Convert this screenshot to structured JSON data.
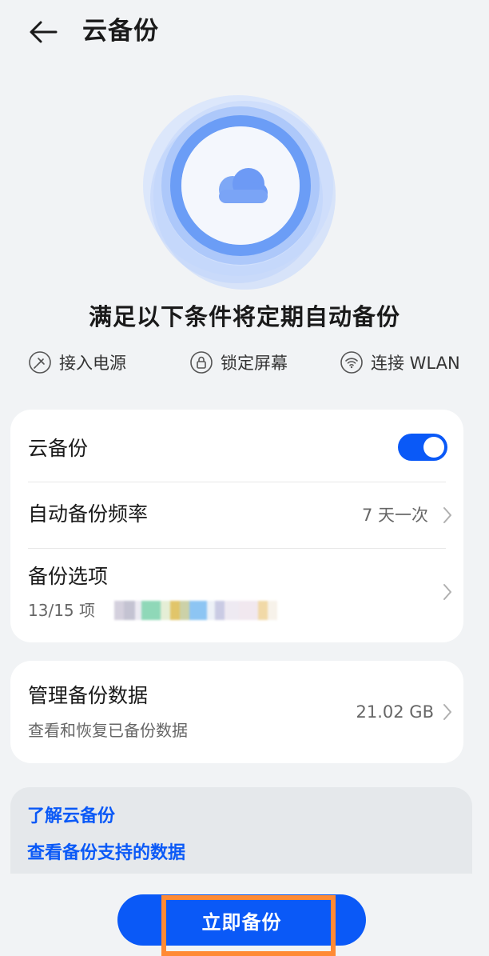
{
  "header": {
    "title": "云备份",
    "back_icon": "arrow-left-icon"
  },
  "hero": {
    "icon": "cloud-icon",
    "accent": "#5a8ff5"
  },
  "conditions": {
    "title": "满足以下条件将定期自动备份",
    "items": [
      {
        "icon": "power-plug-icon",
        "label": "接入电源"
      },
      {
        "icon": "lock-icon",
        "label": "锁定屏幕"
      },
      {
        "icon": "wifi-icon",
        "label": "连接 WLAN"
      }
    ]
  },
  "settings": {
    "cloud_backup": {
      "label": "云备份",
      "enabled": true
    },
    "frequency": {
      "label": "自动备份频率",
      "value": "7 天一次"
    },
    "options": {
      "label": "备份选项",
      "sub": "13/15 项"
    }
  },
  "manage": {
    "label": "管理备份数据",
    "sub": "查看和恢复已备份数据",
    "value": "21.02 GB"
  },
  "links": {
    "learn": "了解云备份",
    "supported": "查看备份支持的数据"
  },
  "actions": {
    "backup_now": "立即备份"
  },
  "colors": {
    "accent": "#0a59f7",
    "background": "#f1f3f5",
    "highlight": "#ff8a34"
  }
}
